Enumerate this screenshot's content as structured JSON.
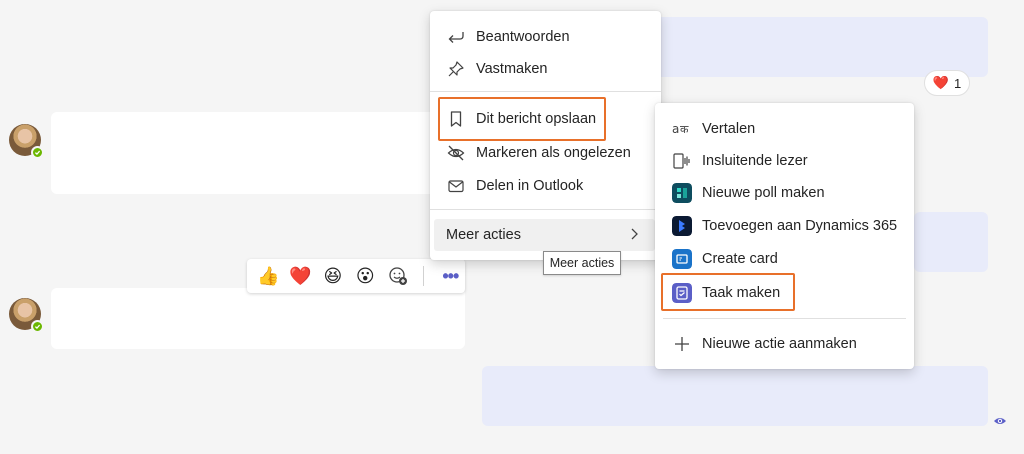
{
  "reaction": {
    "emoji": "❤️",
    "count": "1"
  },
  "quick_reactions": [
    {
      "name": "like",
      "glyph": "👍"
    },
    {
      "name": "heart",
      "glyph": "❤️"
    },
    {
      "name": "laugh",
      "glyph": "😆"
    },
    {
      "name": "surprised",
      "glyph": "😮"
    }
  ],
  "context_menu": {
    "reply": "Beantwoorden",
    "pin": "Vastmaken",
    "save": "Dit bericht opslaan",
    "mark_unread": "Markeren als ongelezen",
    "share_outlook": "Delen in Outlook",
    "more_actions": "Meer acties"
  },
  "tooltip": "Meer acties",
  "more_actions_menu": {
    "translate": "Vertalen",
    "immersive_reader": "Insluitende lezer",
    "new_poll": "Nieuwe poll maken",
    "dynamics": "Toevoegen aan Dynamics 365",
    "create_card": "Create card",
    "create_task": "Taak maken",
    "new_action": "Nieuwe actie aanmaken"
  },
  "colors": {
    "highlight": "#e8702a",
    "accent": "#5b5fc7",
    "status_available": "#6bb700",
    "outgoing_bubble": "#e8ebfa"
  }
}
